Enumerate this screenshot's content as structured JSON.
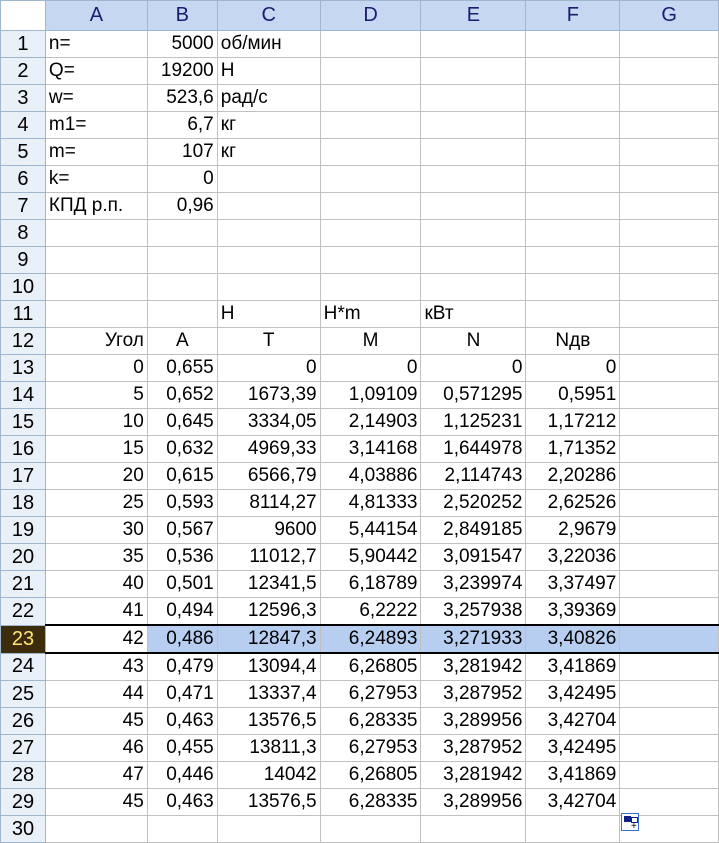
{
  "columns": [
    "A",
    "B",
    "C",
    "D",
    "E",
    "F",
    "G"
  ],
  "rows": [
    [
      "n=",
      "5000",
      "об/мин",
      "",
      "",
      "",
      ""
    ],
    [
      "Q=",
      "19200",
      "Н",
      "",
      "",
      "",
      ""
    ],
    [
      "w=",
      "523,6",
      "рад/с",
      "",
      "",
      "",
      ""
    ],
    [
      "m1=",
      "6,7",
      "кг",
      "",
      "",
      "",
      ""
    ],
    [
      "m=",
      "107",
      "кг",
      "",
      "",
      "",
      ""
    ],
    [
      "k=",
      "0",
      "",
      "",
      "",
      "",
      ""
    ],
    [
      "КПД р.п.",
      "0,96",
      "",
      "",
      "",
      "",
      ""
    ],
    [
      "",
      "",
      "",
      "",
      "",
      "",
      ""
    ],
    [
      "",
      "",
      "",
      "",
      "",
      "",
      ""
    ],
    [
      "",
      "",
      "",
      "",
      "",
      "",
      ""
    ],
    [
      "",
      "",
      "Н",
      "Н*m",
      "кВт",
      "",
      ""
    ],
    [
      "Угол",
      "A",
      "T",
      "M",
      "N",
      "Nдв",
      ""
    ],
    [
      "0",
      "0,655",
      "0",
      "0",
      "0",
      "0",
      ""
    ],
    [
      "5",
      "0,652",
      "1673,39",
      "1,09109",
      "0,571295",
      "0,5951",
      ""
    ],
    [
      "10",
      "0,645",
      "3334,05",
      "2,14903",
      "1,125231",
      "1,17212",
      ""
    ],
    [
      "15",
      "0,632",
      "4969,33",
      "3,14168",
      "1,644978",
      "1,71352",
      ""
    ],
    [
      "20",
      "0,615",
      "6566,79",
      "4,03886",
      "2,114743",
      "2,20286",
      ""
    ],
    [
      "25",
      "0,593",
      "8114,27",
      "4,81333",
      "2,520252",
      "2,62526",
      ""
    ],
    [
      "30",
      "0,567",
      "9600",
      "5,44154",
      "2,849185",
      "2,9679",
      ""
    ],
    [
      "35",
      "0,536",
      "11012,7",
      "5,90442",
      "3,091547",
      "3,22036",
      ""
    ],
    [
      "40",
      "0,501",
      "12341,5",
      "6,18789",
      "3,239974",
      "3,37497",
      ""
    ],
    [
      "41",
      "0,494",
      "12596,3",
      "6,2222",
      "3,257938",
      "3,39369",
      ""
    ],
    [
      "42",
      "0,486",
      "12847,3",
      "6,24893",
      "3,271933",
      "3,40826",
      ""
    ],
    [
      "43",
      "0,479",
      "13094,4",
      "6,26805",
      "3,281942",
      "3,41869",
      ""
    ],
    [
      "44",
      "0,471",
      "13337,4",
      "6,27953",
      "3,287952",
      "3,42495",
      ""
    ],
    [
      "45",
      "0,463",
      "13576,5",
      "6,28335",
      "3,289956",
      "3,42704",
      ""
    ],
    [
      "46",
      "0,455",
      "13811,3",
      "6,27953",
      "3,287952",
      "3,42495",
      ""
    ],
    [
      "47",
      "0,446",
      "14042",
      "6,26805",
      "3,281942",
      "3,41869",
      ""
    ],
    [
      "45",
      "0,463",
      "13576,5",
      "6,28335",
      "3,289956",
      "3,42704",
      ""
    ],
    [
      "",
      "",
      "",
      "",
      "",
      "",
      ""
    ]
  ],
  "selected_row": 23,
  "active_cell": "A23"
}
